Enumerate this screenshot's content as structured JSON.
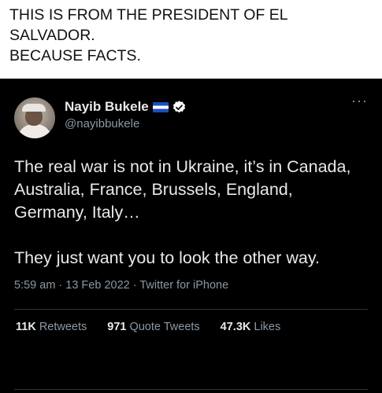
{
  "caption": {
    "line1": "THIS IS FROM THE PRESIDENT OF EL",
    "line2": "SALVADOR.",
    "line3": "BECAUSE FACTS."
  },
  "tweet": {
    "display_name": "Nayib Bukele",
    "handle": "@nayibbukele",
    "more_glyph": "···",
    "paragraph1": "The real war is not in Ukraine, it’s in Canada, Australia, France, Brussels, England, Germany, Italy…",
    "paragraph2": "They just want you to look the other way.",
    "meta": "5:59 am · 13 Feb 2022 · Twitter for iPhone",
    "stats": {
      "retweets_count": "11K",
      "retweets_label": "Retweets",
      "quotes_count": "971",
      "quotes_label": "Quote Tweets",
      "likes_count": "47.3K",
      "likes_label": "Likes"
    }
  },
  "colors": {
    "background": "#000000",
    "text": "#e7e9ea",
    "muted": "#8b98a5",
    "verified": "#ffffff",
    "flag_blue": "#1a4fbf"
  },
  "icons": {
    "verified": "verified-badge-icon",
    "flag": "el-salvador-flag-icon",
    "more": "more-options-icon"
  }
}
